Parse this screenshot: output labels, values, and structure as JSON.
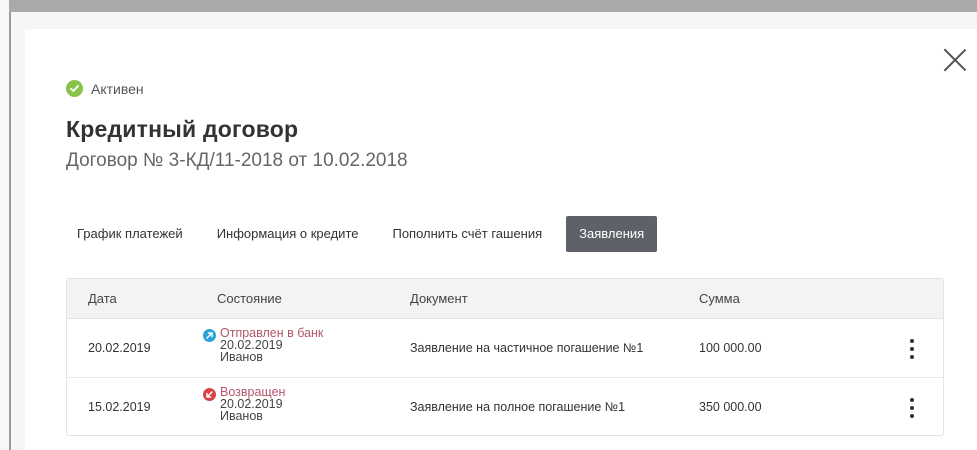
{
  "status": {
    "label": "Активен",
    "color": "#8bc34a",
    "icon": "check-circle-icon"
  },
  "title": "Кредитный договор",
  "subtitle": "Договор № 3-КД/11-2018 от 10.02.2018",
  "tabs": [
    {
      "label": "График платежей",
      "active": false
    },
    {
      "label": "Информация о кредите",
      "active": false
    },
    {
      "label": "Пополнить счёт гашения",
      "active": false
    },
    {
      "label": "Заявления",
      "active": true
    }
  ],
  "table": {
    "headers": [
      "Дата",
      "Состояние",
      "Документ",
      "Сумма"
    ],
    "rows": [
      {
        "date": "20.02.2019",
        "state": {
          "label": "Отправлен в банк",
          "date": "20.02.2019",
          "person": "Иванов",
          "icon": "sent-arrow-icon",
          "icon_color": "#29a3d6"
        },
        "document": "Заявление на частичное погашение №1",
        "sum": "100 000.00"
      },
      {
        "date": "15.02.2019",
        "state": {
          "label": "Возвращен",
          "date": "20.02.2019",
          "person": "Иванов",
          "icon": "returned-arrow-icon",
          "icon_color": "#d84343"
        },
        "document": "Заявление на полное погашение №1",
        "sum": "350 000.00"
      }
    ]
  },
  "colors": {
    "active_tab_bg": "#5e6168",
    "state_label": "#b2566a"
  }
}
